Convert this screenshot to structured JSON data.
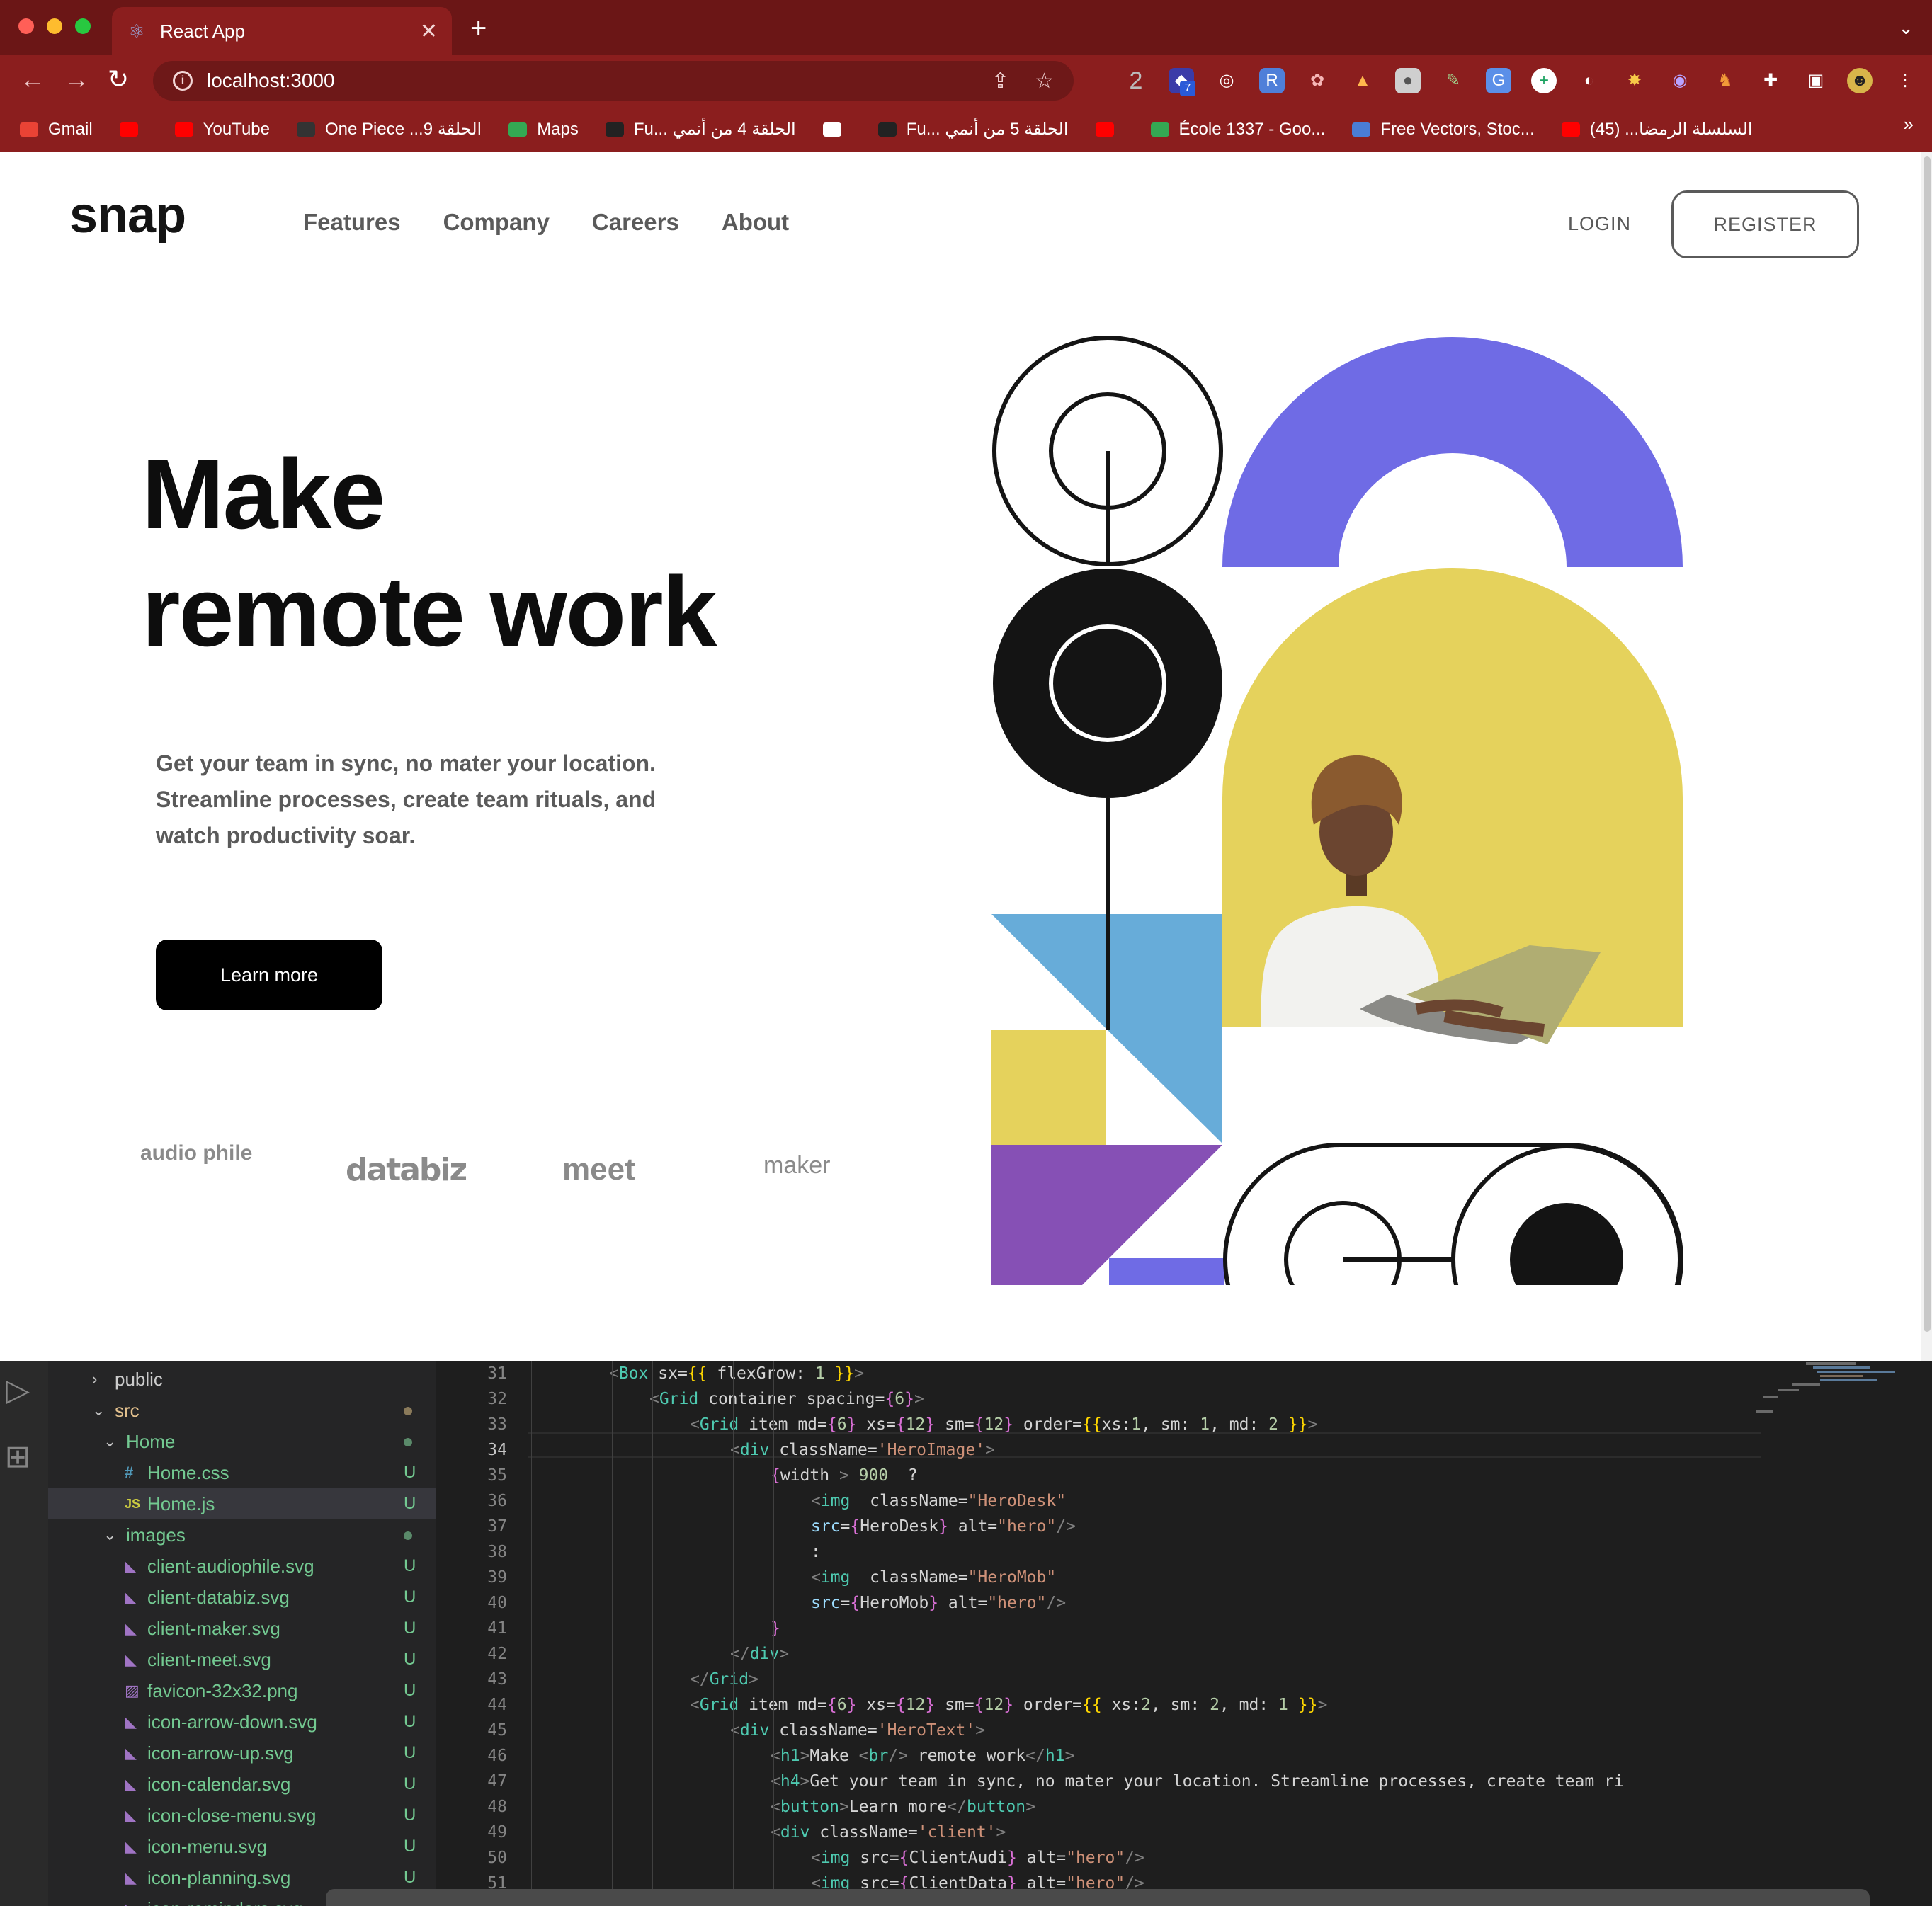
{
  "browser": {
    "tab_title": "React App",
    "url": "localhost:3000",
    "new_tab": "+",
    "bookmarks": [
      {
        "label": "Gmail",
        "color": "#ea4335"
      },
      {
        "label": "",
        "color": "#ff0000"
      },
      {
        "label": "YouTube",
        "color": "#ff0000"
      },
      {
        "label": "One Piece ...الحلقة 9",
        "color": "#333333"
      },
      {
        "label": "Maps",
        "color": "#34a853"
      },
      {
        "label": "Fu... الحلقة 4 من أنمي",
        "color": "#222222"
      },
      {
        "label": "",
        "color": "#ffffff"
      },
      {
        "label": "Fu... الحلقة 5 من أنمي",
        "color": "#222222"
      },
      {
        "label": "",
        "color": "#ff0000"
      },
      {
        "label": "École 1337 - Goo...",
        "color": "#34a853"
      },
      {
        "label": "Free Vectors, Stoc...",
        "color": "#4a7dd6"
      },
      {
        "label": "السلسلة الرمضا... (45)",
        "color": "#ff0000"
      }
    ],
    "bookmarks_more": "»",
    "extensions_count": "2",
    "extension_badge": "7"
  },
  "site": {
    "logo": "snap",
    "nav": [
      "Features",
      "Company",
      "Careers",
      "About"
    ],
    "login": "LOGIN",
    "register": "REGISTER",
    "hero_line1": "Make",
    "hero_line2": "remote work",
    "hero_text": "Get your team in sync, no mater your location. Streamline processes, create team rituals, and watch productivity soar.",
    "cta": "Learn more",
    "clients": [
      "audio phile",
      "databiz",
      "meet",
      "maker"
    ],
    "colors": {
      "purple": "#6f6be5",
      "yellow": "#e5d25c",
      "blue": "#67acd9",
      "violet": "#8650b5",
      "black": "#141414"
    }
  },
  "explorer": {
    "rows": [
      {
        "name": "public",
        "type": "folder-closed",
        "depth": 0,
        "badge": ""
      },
      {
        "name": "src",
        "type": "folder-open",
        "depth": 0,
        "badge": "dot"
      },
      {
        "name": "Home",
        "type": "folder-open",
        "depth": 1,
        "badge": "dot"
      },
      {
        "name": "Home.css",
        "type": "css",
        "depth": 2,
        "badge": "U"
      },
      {
        "name": "Home.js",
        "type": "js",
        "depth": 2,
        "badge": "U"
      },
      {
        "name": "images",
        "type": "folder-open",
        "depth": 1,
        "badge": "dot"
      },
      {
        "name": "client-audiophile.svg",
        "type": "svg",
        "depth": 2,
        "badge": "U"
      },
      {
        "name": "client-databiz.svg",
        "type": "svg",
        "depth": 2,
        "badge": "U"
      },
      {
        "name": "client-maker.svg",
        "type": "svg",
        "depth": 2,
        "badge": "U"
      },
      {
        "name": "client-meet.svg",
        "type": "svg",
        "depth": 2,
        "badge": "U"
      },
      {
        "name": "favicon-32x32.png",
        "type": "png",
        "depth": 2,
        "badge": "U"
      },
      {
        "name": "icon-arrow-down.svg",
        "type": "svg",
        "depth": 2,
        "badge": "U"
      },
      {
        "name": "icon-arrow-up.svg",
        "type": "svg",
        "depth": 2,
        "badge": "U"
      },
      {
        "name": "icon-calendar.svg",
        "type": "svg",
        "depth": 2,
        "badge": "U"
      },
      {
        "name": "icon-close-menu.svg",
        "type": "svg",
        "depth": 2,
        "badge": "U"
      },
      {
        "name": "icon-menu.svg",
        "type": "svg",
        "depth": 2,
        "badge": "U"
      },
      {
        "name": "icon-planning.svg",
        "type": "svg",
        "depth": 2,
        "badge": "U"
      },
      {
        "name": "icon-reminders.svg",
        "type": "svg",
        "depth": 2,
        "badge": ""
      }
    ],
    "selected": "Home.js"
  },
  "editor": {
    "current_line": 34,
    "lines": [
      {
        "n": 31,
        "indent": 6,
        "code": "<Box sx={{ flexGrow: 1 }}>"
      },
      {
        "n": 32,
        "indent": 7,
        "code": "<Grid container spacing={6}>"
      },
      {
        "n": 33,
        "indent": 8,
        "code": "<Grid item md={6} xs={12} sm={12} order={{xs:1, sm: 1, md: 2 }}>"
      },
      {
        "n": 34,
        "indent": 9,
        "code": "<div className='HeroImage'>"
      },
      {
        "n": 35,
        "indent": 10,
        "code": "{width > 900  ?"
      },
      {
        "n": 36,
        "indent": 11,
        "code": "<img  className=\"HeroDesk\""
      },
      {
        "n": 37,
        "indent": 11,
        "code": "src={HeroDesk} alt=\"hero\"/>"
      },
      {
        "n": 38,
        "indent": 11,
        "code": ":"
      },
      {
        "n": 39,
        "indent": 11,
        "code": "<img  className=\"HeroMob\""
      },
      {
        "n": 40,
        "indent": 11,
        "code": "src={HeroMob} alt=\"hero\"/>"
      },
      {
        "n": 41,
        "indent": 10,
        "code": "}"
      },
      {
        "n": 42,
        "indent": 9,
        "code": "</div>"
      },
      {
        "n": 43,
        "indent": 8,
        "code": "</Grid>"
      },
      {
        "n": 44,
        "indent": 8,
        "code": "<Grid item md={6} xs={12} sm={12} order={{ xs:2, sm: 2, md: 1 }}>"
      },
      {
        "n": 45,
        "indent": 9,
        "code": "<div className='HeroText'>"
      },
      {
        "n": 46,
        "indent": 10,
        "code": "<h1>Make <br/> remote work</h1>"
      },
      {
        "n": 47,
        "indent": 10,
        "code": "<h4>Get your team in sync, no mater your location. Streamline processes, create team ri"
      },
      {
        "n": 48,
        "indent": 10,
        "code": "<button>Learn more</button>"
      },
      {
        "n": 49,
        "indent": 10,
        "code": "<div className='client'>"
      },
      {
        "n": 50,
        "indent": 11,
        "code": "<img src={ClientAudi} alt=\"hero\"/>"
      },
      {
        "n": 51,
        "indent": 11,
        "code": "<img src={ClientData} alt=\"hero\"/>"
      }
    ]
  }
}
